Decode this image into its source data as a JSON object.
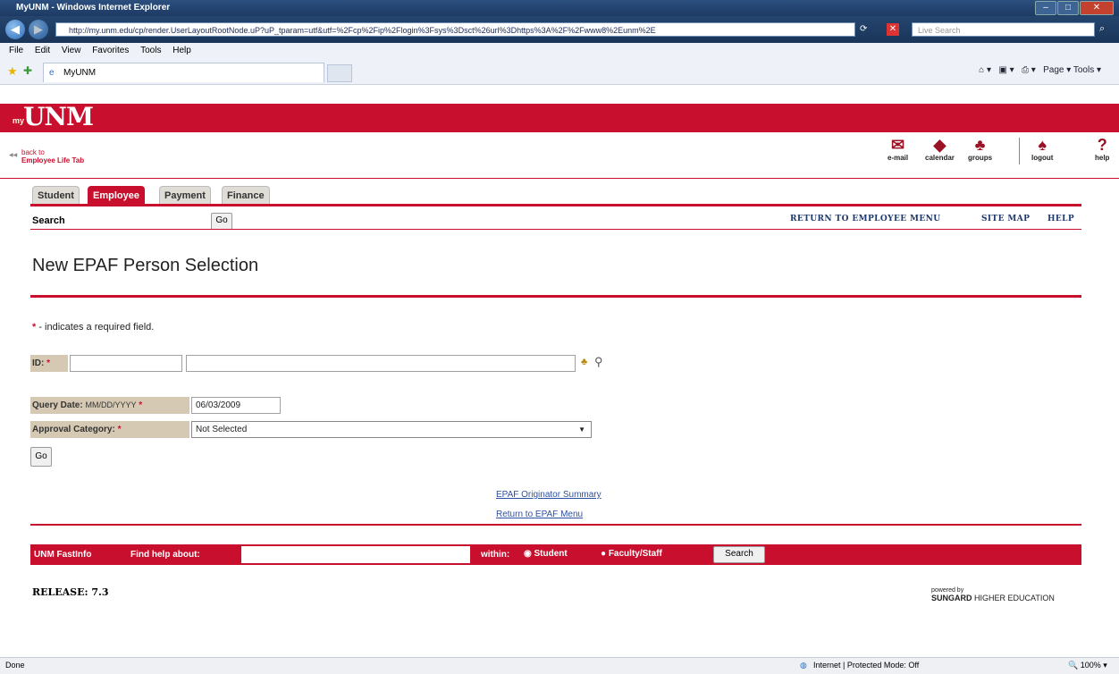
{
  "window": {
    "title": "MyUNM - Windows Internet Explorer",
    "url": "http://my.unm.edu/cp/render.UserLayoutRootNode.uP?uP_tparam=utf&utf=%2Fcp%2Fip%2Flogin%3Fsys%3Dsct%26url%3Dhttps%3A%2F%2Fwww8%2Eunm%2E",
    "live_search_placeholder": "Live Search",
    "menu": [
      "File",
      "Edit",
      "View",
      "Favorites",
      "Tools",
      "Help"
    ],
    "tab_title": "MyUNM",
    "command_bar": "Page ▾  Tools ▾"
  },
  "portal": {
    "logo_small": "my",
    "logo_main": "UNM",
    "back_line1": "back to",
    "back_line2": "Employee Life Tab",
    "icons": [
      {
        "label": "e-mail",
        "icon": "envelope-icon",
        "glyph": "✉"
      },
      {
        "label": "calendar",
        "icon": "calendar-icon",
        "glyph": "◆"
      },
      {
        "label": "groups",
        "icon": "groups-icon",
        "glyph": "♣"
      },
      {
        "label": "logout",
        "icon": "logout-icon",
        "glyph": "♠"
      },
      {
        "label": "help",
        "icon": "help-icon",
        "glyph": "?"
      }
    ]
  },
  "tabs": [
    "Student",
    "Employee",
    "Payment",
    "Finance"
  ],
  "active_tab": "Employee",
  "search": {
    "label": "Search",
    "go": "Go"
  },
  "nav_links": [
    "RETURN TO EMPLOYEE MENU",
    "SITE MAP",
    "HELP"
  ],
  "page_title": "New EPAF Person Selection",
  "required_note": " - indicates a required field.",
  "form": {
    "id_label": "ID:",
    "query_date_label": "Query Date:",
    "query_date_format": "MM/DD/YYYY",
    "query_date_value": "06/03/2009",
    "approval_label": "Approval Category:",
    "approval_value": "Not Selected",
    "go_button": "Go"
  },
  "links": [
    "EPAF Originator Summary",
    "Return to EPAF Menu"
  ],
  "fastinfo": {
    "brand": "UNM FastInfo",
    "find_label": "Find help about:",
    "within_label": "within:",
    "options": [
      "Student",
      "Faculty/Staff"
    ],
    "search_button": "Search"
  },
  "release": "RELEASE: 7.3",
  "powered_by": {
    "line1": "powered by",
    "line2": "SUNGARD",
    "line3": "HIGHER EDUCATION"
  },
  "status": {
    "left": "Done",
    "zone": "Internet | Protected Mode: Off",
    "zoom": "100%"
  },
  "colors": {
    "accent": "#c8102e",
    "label_bg": "#d6c9b3",
    "link": "#2c4fa3"
  }
}
